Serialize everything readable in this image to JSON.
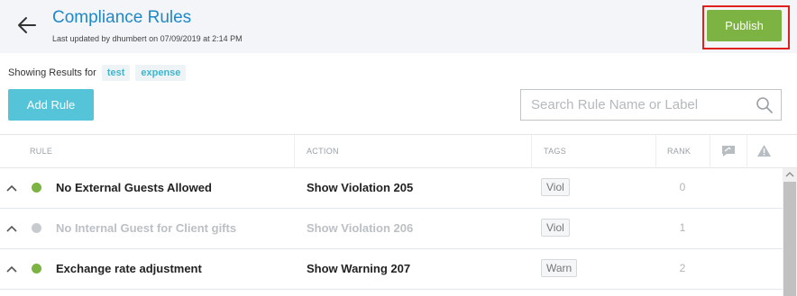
{
  "header": {
    "title": "Compliance Rules",
    "last_updated": "Last updated by dhumbert on 07/09/2019 at 2:14 PM",
    "publish_label": "Publish",
    "publish_color": "#7cb342",
    "highlight_color": "#e0201c"
  },
  "filter": {
    "label": "Showing Results for",
    "tags": [
      "test",
      "expense"
    ]
  },
  "toolbar": {
    "add_rule_label": "Add Rule",
    "search_placeholder": "Search Rule Name or Label"
  },
  "table": {
    "columns": {
      "rule": "RULE",
      "action": "ACTION",
      "tags": "TAGS",
      "rank": "RANK"
    },
    "rows": [
      {
        "name": "No External Guests Allowed",
        "action": "Show Violation 205",
        "tag": "Viol",
        "rank": "0",
        "active": true
      },
      {
        "name": "No Internal Guest for Client gifts",
        "action": "Show Violation 206",
        "tag": "Viol",
        "rank": "1",
        "active": false
      },
      {
        "name": "Exchange rate adjustment",
        "action": "Show Warning 207",
        "tag": "Warn",
        "rank": "2",
        "active": true
      }
    ]
  },
  "icons": {
    "back": "arrow-left-icon",
    "search": "search-icon",
    "comment": "comment-icon",
    "warning": "warning-icon",
    "chevron": "chevron-up-icon"
  },
  "colors": {
    "title": "#1e88c8",
    "add_rule": "#56c4d8",
    "tag_chip_text": "#3fb6cc",
    "active_dot": "#7cb342",
    "inactive_dot": "#c8cbce"
  }
}
